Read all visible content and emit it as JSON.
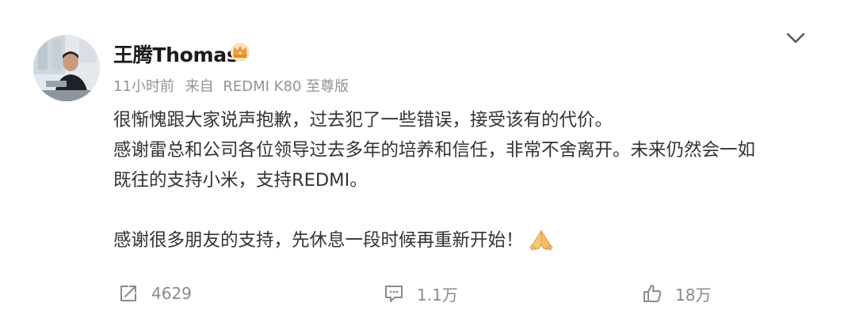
{
  "post": {
    "author": "王腾Thomas",
    "badge_icon": "crown-badge-icon",
    "time": "11小时前",
    "source_prefix": "来自",
    "source_device": "REDMI K80 至尊版",
    "paragraphs": [
      "很惭愧跟大家说声抱歉，过去犯了一些错误，接受该有的代价。",
      "感谢雷总和公司各位领导过去多年的培养和信任，非常不舍离开。未来仍然会一如",
      "既往的支持小米，支持REDMI。",
      "感谢很多朋友的支持，先休息一段时候再重新开始！"
    ],
    "emoji": "folded-hands-icon"
  },
  "actions": {
    "repost_count": "4629",
    "comment_count": "1.1万",
    "like_count": "18万"
  },
  "colors": {
    "name": "#1a1a1a",
    "text": "#333333",
    "meta": "#939393",
    "icon": "#8a8a8a"
  }
}
